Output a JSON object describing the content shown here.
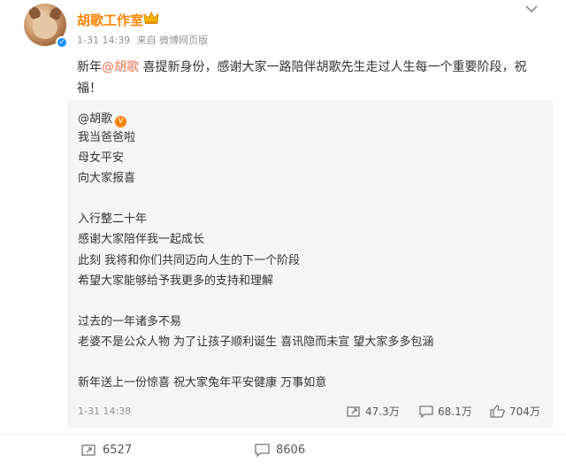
{
  "post": {
    "author": "胡歌工作室",
    "verify_mark": "✓",
    "meta_time": "1-31 14:39",
    "meta_source": "来自 微博网页版",
    "text_prefix": "新年",
    "mention": "@胡歌",
    "text_suffix": " 喜提新身份，感谢大家一路陪伴胡歌先生走过人生每一个重要阶段，祝福！"
  },
  "repost": {
    "author": "@胡歌",
    "verify_mark": "V",
    "lines": [
      "我当爸爸啦",
      "母女平安",
      "向大家报喜",
      "",
      "入行整二十年",
      "感谢大家陪伴我一起成长",
      "此刻 我将和你们共同迈向人生的下一个阶段",
      "希望大家能够给予我更多的支持和理解",
      "",
      "过去的一年诸多不易",
      "老婆不是公众人物 为了让孩子顺利诞生 喜讯隐而未宣 望大家多多包涵",
      "",
      "新年送上一份惊喜 祝大家兔年平安健康 万事如意"
    ],
    "time": "1-31 14:38",
    "reposts": "47.3万",
    "comments": "68.1万",
    "likes": "704万"
  },
  "actions": {
    "repost_count": "6527",
    "comment_count": "8606"
  },
  "colors": {
    "username": "#ff8200",
    "mention": "#eb7350",
    "repost_bg": "#f5f5f5",
    "verify_blue": "#1e90ff"
  }
}
